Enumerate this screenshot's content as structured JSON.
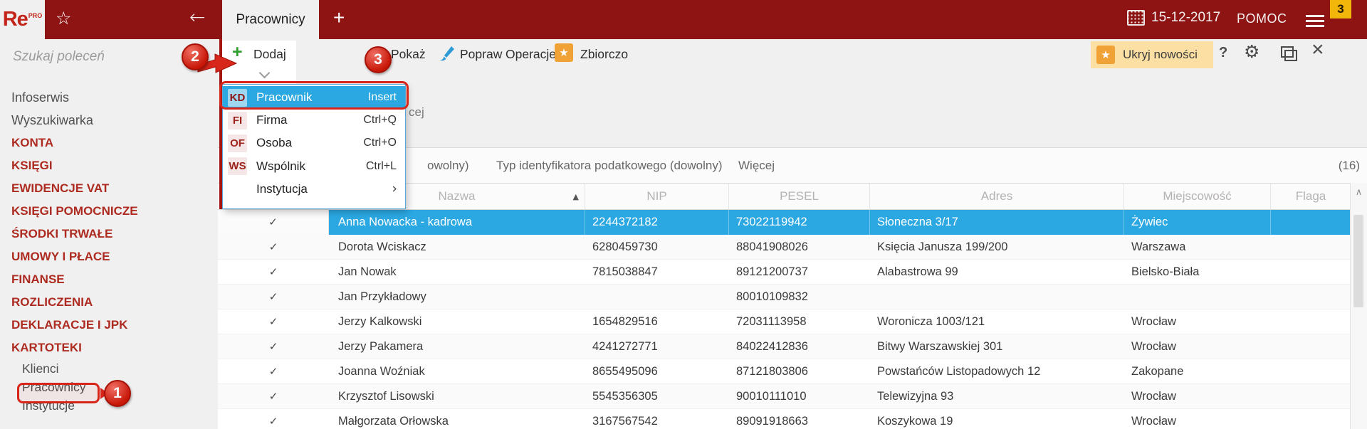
{
  "topbar": {
    "logo_text": "Re",
    "logo_sup": "PRO",
    "tab": "Pracownicy",
    "new_tab": "+",
    "date": "15-12-2017",
    "help": "POMOC",
    "badge": "3"
  },
  "sidebar": {
    "search_placeholder": "Szukaj poleceń",
    "items": [
      {
        "label": "Infoserwis",
        "type": "link"
      },
      {
        "label": "Wyszukiwarka",
        "type": "link"
      },
      {
        "label": "KONTA",
        "type": "section"
      },
      {
        "label": "KSIĘGI",
        "type": "section"
      },
      {
        "label": "EWIDENCJE VAT",
        "type": "section"
      },
      {
        "label": "KSIĘGI POMOCNICZE",
        "type": "section"
      },
      {
        "label": "ŚRODKI TRWAŁE",
        "type": "section"
      },
      {
        "label": "UMOWY I PŁACE",
        "type": "section"
      },
      {
        "label": "FINANSE",
        "type": "section"
      },
      {
        "label": "ROZLICZENIA",
        "type": "section"
      },
      {
        "label": "DEKLARACJE I JPK",
        "type": "section"
      },
      {
        "label": "KARTOTEKI",
        "type": "section"
      },
      {
        "label": "Klienci",
        "type": "sublink"
      },
      {
        "label": "Pracownicy",
        "type": "sublink",
        "current": true
      },
      {
        "label": "Instytucje",
        "type": "sublink"
      }
    ]
  },
  "toolbar": {
    "add": "Dodaj",
    "show": "Pokaż",
    "edit": "Popraw",
    "operations": "Operacje",
    "bulk": "Zbiorczo",
    "hide_news": "Ukryj nowości",
    "help": "?"
  },
  "dropdown": {
    "items": [
      {
        "badge": "KD",
        "label": "Pracownik",
        "shortcut": "Insert",
        "selected": true
      },
      {
        "badge": "FI",
        "label": "Firma",
        "shortcut": "Ctrl+Q"
      },
      {
        "badge": "OF",
        "label": "Osoba",
        "shortcut": "Ctrl+O"
      },
      {
        "badge": "WS",
        "label": "Wspólnik",
        "shortcut": "Ctrl+L"
      },
      {
        "badge": "",
        "label": "Instytucja",
        "submenu": true
      }
    ]
  },
  "breadcrumb_fragment": "cej",
  "filterbar": {
    "fragment": "owolny)",
    "tax_filter": "Typ identyfikatora podatkowego (dowolny)",
    "more": "Więcej",
    "count": "(16)"
  },
  "table": {
    "columns": [
      "",
      "Nazwa",
      "NIP",
      "PESEL",
      "Adres",
      "Miejscowość",
      "Flaga"
    ],
    "sort_column": "Nazwa",
    "rows": [
      {
        "checked": true,
        "name": "Anna Nowacka - kadrowa",
        "nip": "2244372182",
        "pesel": "73022119942",
        "address": "Słoneczna 3/17",
        "city": "Żywiec",
        "flag": "",
        "selected": true
      },
      {
        "checked": true,
        "name": "Dorota Wciskacz",
        "nip": "6280459730",
        "pesel": "88041908026",
        "address": "Księcia Janusza 199/200",
        "city": "Warszawa",
        "flag": ""
      },
      {
        "checked": true,
        "name": "Jan Nowak",
        "nip": "7815038847",
        "pesel": "89121200737",
        "address": "Alabastrowa 99",
        "city": "Bielsko-Biała",
        "flag": ""
      },
      {
        "checked": true,
        "name": "Jan Przykładowy",
        "nip": "",
        "pesel": "80010109832",
        "address": "",
        "city": "",
        "flag": ""
      },
      {
        "checked": true,
        "name": "Jerzy Kalkowski",
        "nip": "1654829516",
        "pesel": "72031113958",
        "address": "Woronicza 1003/121",
        "city": "Wrocław",
        "flag": ""
      },
      {
        "checked": true,
        "name": "Jerzy Pakamera",
        "nip": "4241272771",
        "pesel": "84022412836",
        "address": "Bitwy Warszawskiej 301",
        "city": "Wrocław",
        "flag": ""
      },
      {
        "checked": true,
        "name": "Joanna Woźniak",
        "nip": "8655495096",
        "pesel": "87121803806",
        "address": "Powstańców Listopadowych 12",
        "city": "Zakopane",
        "flag": ""
      },
      {
        "checked": true,
        "name": "Krzysztof Lisowski",
        "nip": "5545356305",
        "pesel": "90010111010",
        "address": "Telewizyjna 93",
        "city": "Wrocław",
        "flag": ""
      },
      {
        "checked": true,
        "name": "Małgorzata Orłowska",
        "nip": "3167567542",
        "pesel": "89091918663",
        "address": "Koszykowa 19",
        "city": "Wrocław",
        "flag": ""
      }
    ]
  },
  "annotations": {
    "step1": "1",
    "step2": "2",
    "step3": "3"
  },
  "icons": {
    "star_outline": "☆",
    "star": "★",
    "back_arrow": "←",
    "check": "✓",
    "sort_asc": "▲",
    "submenu_arrow": "›",
    "gear": "⚙",
    "close": "×",
    "help": "?",
    "scroll_up": "∧"
  },
  "colors": {
    "topbar_red": "#8E1313",
    "selection_blue": "#2BA7E1",
    "annotation_red": "#D8251A",
    "sidebar_red": "#AD2B20",
    "news_bg": "#FBDFA3",
    "star_orange": "#F0A236",
    "badge_yellow": "#F2B50A",
    "plus_green": "#2F9E2F",
    "brush_blue": "#2E9BD6"
  }
}
